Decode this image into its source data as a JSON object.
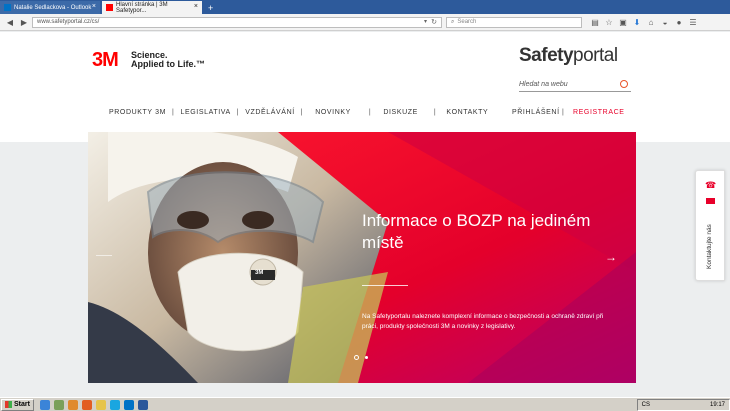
{
  "browser": {
    "tabs": [
      {
        "label": "Natalie Sedlackova - Outlook",
        "favicon_color": "#0072c6"
      },
      {
        "label": "Hlavní stránka | 3M Safetypor...",
        "favicon_color": "#ff0000"
      }
    ],
    "new_tab_label": "+",
    "url": "www.safetyportal.cz/cs/",
    "search_placeholder": "Search"
  },
  "header": {
    "logo_mark": "3M",
    "logo_tagline_line1": "Science.",
    "logo_tagline_line2": "Applied to Life.™",
    "brand_bold": "Safety",
    "brand_light": "portal",
    "site_search_placeholder": "Hledat na webu"
  },
  "nav": {
    "items": [
      "PRODUKTY 3M",
      "LEGISLATIVA",
      "VZDĚLÁVÁNÍ",
      "NOVINKY",
      "DISKUZE",
      "KONTAKTY"
    ],
    "separator": "|",
    "login": "PŘIHLÁŠENÍ",
    "register": "REGISTRACE"
  },
  "hero": {
    "title": "Informace o BOZP na jediném místě",
    "text": "Na Safetyportalu naleznete komplexní informace o bezpečnosti a ochraně zdraví při práci, produkty společnosti 3M a novinky z legislativy.",
    "mask_label": "3M",
    "arrow": "→",
    "active_slide": 1,
    "slide_count": 2
  },
  "contact": {
    "label": "Kontaktujte nás",
    "phone_icon": "☎"
  },
  "taskbar": {
    "start_label": "Start",
    "language": "CS",
    "time": "19:17"
  },
  "colors": {
    "accent_red": "#e8002a",
    "brand_red": "#ff0000",
    "firefox_blue": "#2d5a9b"
  }
}
